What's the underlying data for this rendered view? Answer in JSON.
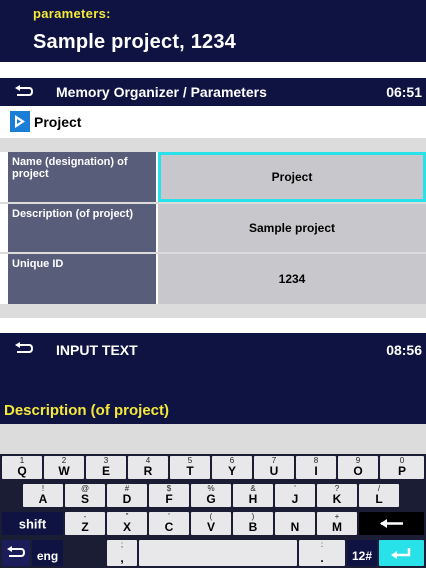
{
  "banner": {
    "label": "parameters:",
    "value": "Sample project, 1234"
  },
  "screen1": {
    "title": "Memory Organizer / Parameters",
    "time": "06:51",
    "section": "Project",
    "rows": [
      {
        "label": "Name (designation) of project",
        "value": "Project"
      },
      {
        "label": "Description (of project)",
        "value": "Sample project"
      },
      {
        "label": "Unique ID",
        "value": "1234"
      }
    ]
  },
  "screen2": {
    "title": "INPUT TEXT",
    "time": "08:56",
    "field_label": "Description (of project)",
    "input_value": ""
  },
  "keyboard": {
    "row1": [
      {
        "main": "Q",
        "alt": "1"
      },
      {
        "main": "W",
        "alt": "2"
      },
      {
        "main": "E",
        "alt": "3"
      },
      {
        "main": "R",
        "alt": "4"
      },
      {
        "main": "T",
        "alt": "5"
      },
      {
        "main": "Y",
        "alt": "6"
      },
      {
        "main": "U",
        "alt": "7"
      },
      {
        "main": "I",
        "alt": "8"
      },
      {
        "main": "O",
        "alt": "9"
      },
      {
        "main": "P",
        "alt": "0"
      }
    ],
    "row2": [
      {
        "main": "A",
        "alt": "!"
      },
      {
        "main": "S",
        "alt": "@"
      },
      {
        "main": "D",
        "alt": "#"
      },
      {
        "main": "F",
        "alt": "$"
      },
      {
        "main": "G",
        "alt": "%"
      },
      {
        "main": "H",
        "alt": "&"
      },
      {
        "main": "J",
        "alt": "'"
      },
      {
        "main": "K",
        "alt": "?"
      },
      {
        "main": "L",
        "alt": "/"
      }
    ],
    "row3": [
      {
        "main": "Z",
        "alt": "-"
      },
      {
        "main": "X",
        "alt": "\""
      },
      {
        "main": "C",
        "alt": "'"
      },
      {
        "main": "V",
        "alt": "("
      },
      {
        "main": "B",
        "alt": ")"
      },
      {
        "main": "N",
        "alt": ""
      },
      {
        "main": "M",
        "alt": "+"
      }
    ],
    "shift": "shift",
    "lang": "eng",
    "comma": {
      "main": ",",
      "alt": ";"
    },
    "dot": {
      "main": ".",
      "alt": ":"
    },
    "symbols": "12#",
    "backspace_icon": "backspace-arrow-icon",
    "enter_icon": "enter-arrow-icon",
    "back_icon": "back-arrow-icon"
  },
  "colors": {
    "header": "#0e1342",
    "accent_yellow": "#f5e83a",
    "accent_cyan": "#29e1e9",
    "label_bg": "#585d7a",
    "value_bg": "#c8c8cc"
  }
}
